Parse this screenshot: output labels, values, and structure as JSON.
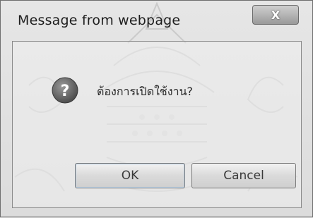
{
  "window": {
    "title": "Message from webpage",
    "close_label": "X"
  },
  "dialog": {
    "icon": "question-icon",
    "message": "ต้องการเปิดใช้งาน?"
  },
  "buttons": {
    "ok_label": "OK",
    "cancel_label": "Cancel"
  },
  "colors": {
    "frame": "#dcdcdc",
    "close_button": "#9a9a9a",
    "question_icon": "#6a6a6a"
  }
}
